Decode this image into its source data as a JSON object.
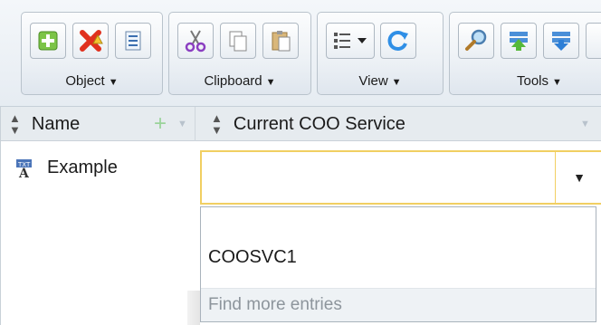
{
  "toolbar": {
    "groups": [
      {
        "label": "Object",
        "buttons": [
          "add-object-icon",
          "delete-object-icon",
          "properties-icon"
        ]
      },
      {
        "label": "Clipboard",
        "buttons": [
          "cut-icon",
          "copy-icon",
          "paste-icon"
        ]
      },
      {
        "label": "View",
        "buttons": [
          "list-view-icon",
          "refresh-icon"
        ]
      },
      {
        "label": "Tools",
        "buttons": [
          "search-icon",
          "move-up-icon",
          "move-down-icon"
        ]
      }
    ]
  },
  "grid": {
    "columns": [
      {
        "label": "Name"
      },
      {
        "label": "Current COO Service"
      }
    ],
    "rows": [
      {
        "name": "Example",
        "value": ""
      }
    ]
  },
  "dropdown": {
    "options": [
      "",
      "COOSVC1"
    ],
    "more_label": "Find more entries"
  },
  "colors": {
    "focus_border": "#f1cf62",
    "header_bg": "#e6ebef",
    "toolbar_bg": "#e6ecf2"
  }
}
